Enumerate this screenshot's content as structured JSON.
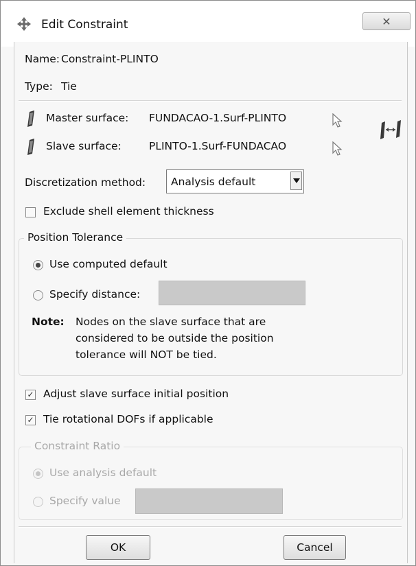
{
  "window": {
    "title": "Edit Constraint",
    "close_glyph": "✕"
  },
  "form": {
    "name_label": "Name:",
    "name_value": "Constraint-PLINTO",
    "type_label": "Type:",
    "type_value": "Tie",
    "master_label": "Master surface:",
    "master_value": "FUNDACAO-1.Surf-PLINTO",
    "slave_label": "Slave surface:",
    "slave_value": "PLINTO-1.Surf-FUNDACAO",
    "discretization_label": "Discretization method:",
    "discretization_value": "Analysis default",
    "exclude_shell_label": "Exclude shell element thickness",
    "exclude_shell_checked": false
  },
  "position_tolerance": {
    "title": "Position Tolerance",
    "use_computed_label": "Use computed default",
    "use_computed_selected": true,
    "specify_distance_label": "Specify distance:",
    "specify_distance_value": "",
    "note_label": "Note:",
    "note_line1": "Nodes on the slave surface that are",
    "note_line2": "considered to be outside the position",
    "note_line3": "tolerance will NOT be tied."
  },
  "options": {
    "adjust_label": "Adjust slave surface initial position",
    "adjust_checked": true,
    "tie_rot_label": "Tie rotational DOFs if applicable",
    "tie_rot_checked": true
  },
  "constraint_ratio": {
    "title": "Constraint Ratio",
    "use_analysis_label": "Use analysis default",
    "use_analysis_selected": true,
    "specify_value_label": "Specify value",
    "specify_value_value": ""
  },
  "buttons": {
    "ok_label": "OK",
    "cancel_label": "Cancel"
  },
  "glyphs": {
    "check_mark": "✓"
  },
  "icons": [
    "move-arrows-icon",
    "surface-icon",
    "pointer-arrow-icon",
    "swap-surfaces-icon",
    "chevron-down-icon"
  ]
}
